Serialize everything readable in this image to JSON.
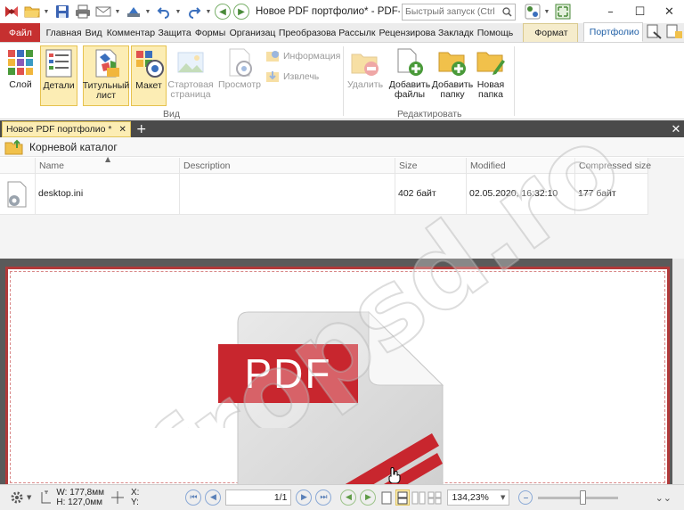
{
  "title_bar": {
    "app_title": "Новое PDF портфолио* - PDF-XCh...",
    "search_placeholder": "Быстрый запуск (Ctrl...",
    "minimize": "–",
    "maximize": "☐",
    "close": "✕"
  },
  "ribbon_tabs": [
    {
      "label": "Файл"
    },
    {
      "label": "Главная"
    },
    {
      "label": "Вид"
    },
    {
      "label": "Комментар"
    },
    {
      "label": "Защита"
    },
    {
      "label": "Формы"
    },
    {
      "label": "Организац"
    },
    {
      "label": "Преобразова"
    },
    {
      "label": "Рассылк"
    },
    {
      "label": "Рецензирова"
    },
    {
      "label": "Закладк"
    },
    {
      "label": "Помощь"
    }
  ],
  "context_tabs": {
    "format": "Формат",
    "portfolio": "Портфолио"
  },
  "ribbon": {
    "view_group": {
      "label": "Вид",
      "layer": "Слой",
      "details": "Детали",
      "cover_1": "Титульный",
      "cover_2": "лист",
      "layout": "Макет",
      "start_1": "Стартовая",
      "start_2": "страница",
      "preview": "Просмотр",
      "info": "Информация",
      "extract": "Извлечь"
    },
    "edit_group": {
      "label": "Редактировать",
      "delete": "Удалить",
      "add_files_1": "Добавить",
      "add_files_2": "файлы",
      "add_folder_1": "Добавить",
      "add_folder_2": "папку",
      "new_folder_1": "Новая",
      "new_folder_2": "папка"
    }
  },
  "doc_tab": {
    "label": "Новое PDF портфолио *",
    "close": "✕",
    "new": "+"
  },
  "portfolio": {
    "breadcrumb": "Корневой каталог",
    "columns": [
      "",
      "Name",
      "Description",
      "Size",
      "Modified",
      "Compressed size"
    ],
    "rows": [
      {
        "name": "desktop.ini",
        "description": "",
        "size": "402 байт",
        "modified": "02.05.2020, 16:32:10",
        "compressed": "177 байт"
      }
    ]
  },
  "document": {
    "pdf_label": "PDF"
  },
  "status_bar": {
    "width": "W: 177,8мм",
    "height": "H: 127,0мм",
    "x": "X:",
    "y": "Y:",
    "page": "1/1",
    "zoom": "134,23%",
    "zoom_slider_level": 0.55
  },
  "watermark": {
    "text": "fropsd.ro"
  },
  "colors": {
    "file_tab": "#c63030",
    "portfolio_tab_text": "#1f5fa6",
    "selected_button": "#fcedb4",
    "pdf_red": "#c8262e",
    "doc_tab": "#fcedb4"
  }
}
